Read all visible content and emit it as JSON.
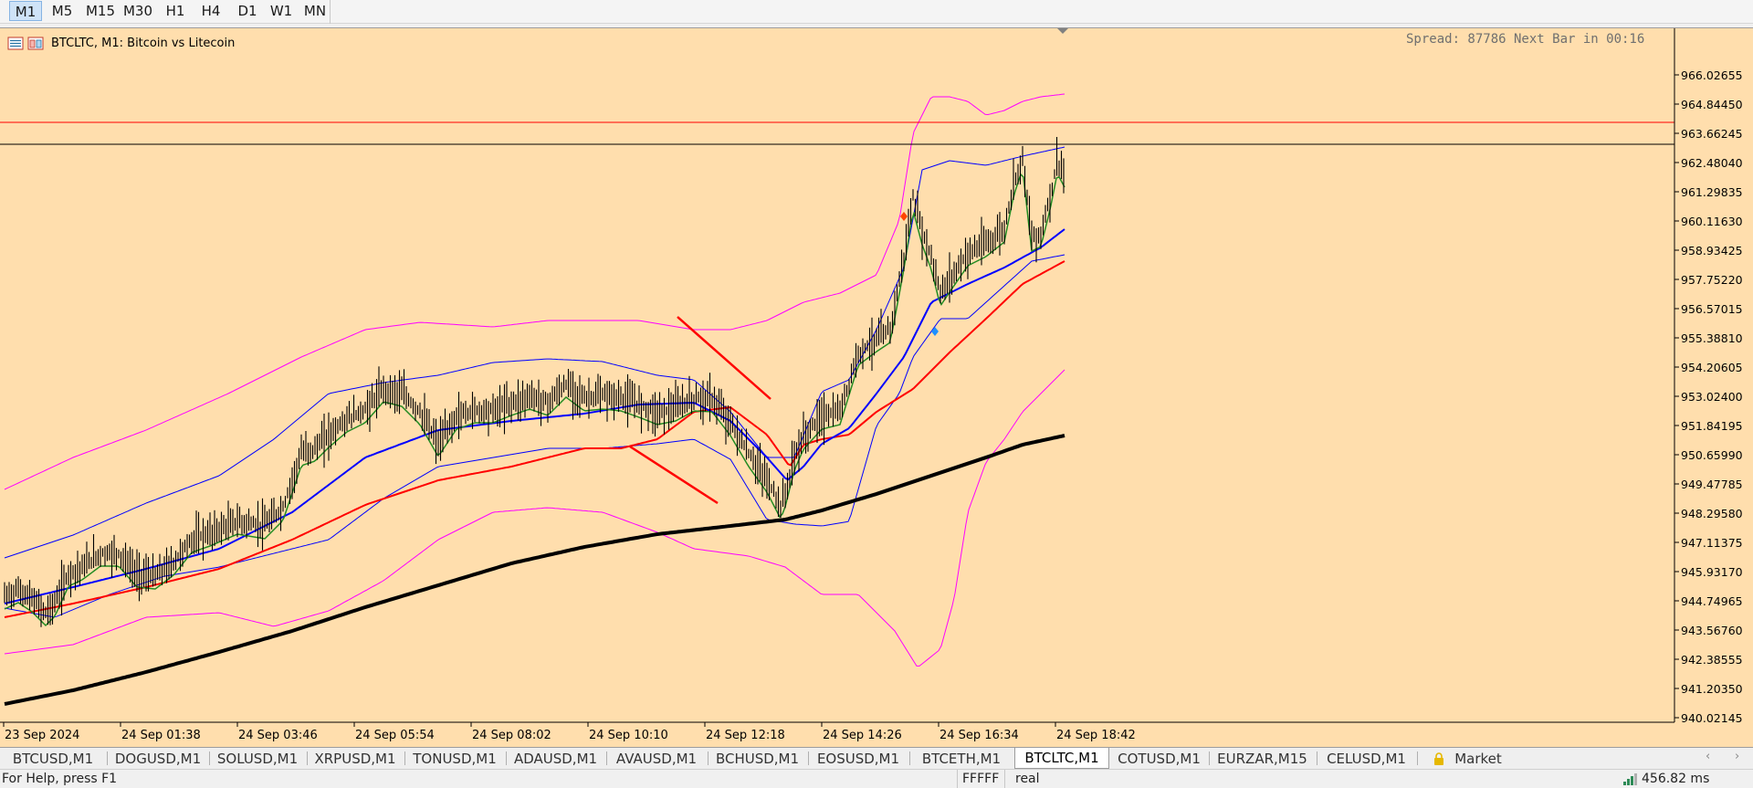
{
  "toolbar": {
    "timeframes": [
      {
        "label": "M1",
        "active": true
      },
      {
        "label": "M5",
        "active": false
      },
      {
        "label": "M15",
        "active": false
      },
      {
        "label": "M30",
        "active": false
      },
      {
        "label": "H1",
        "active": false
      },
      {
        "label": "H4",
        "active": false
      },
      {
        "label": "D1",
        "active": false
      },
      {
        "label": "W1",
        "active": false
      },
      {
        "label": "MN",
        "active": false
      }
    ]
  },
  "chart": {
    "title": "BTCLTC, M1:  Bitcoin vs Litecoin",
    "spread_text": "Spread: 87786 Next Bar in 00:16",
    "icons": [
      "chart-list-icon",
      "chart-window-icon"
    ],
    "price_axis": [
      "966.02655",
      "964.84450",
      "963.66245",
      "962.48040",
      "961.29835",
      "960.11630",
      "958.93425",
      "957.75220",
      "956.57015",
      "955.38810",
      "954.20605",
      "953.02400",
      "951.84195",
      "950.65990",
      "949.47785",
      "948.29580",
      "947.11375",
      "945.93170",
      "944.74965",
      "943.56760",
      "942.38555",
      "941.20350",
      "940.02145"
    ],
    "time_axis": [
      "23 Sep 2024",
      "24 Sep 01:38",
      "24 Sep 03:46",
      "24 Sep 05:54",
      "24 Sep 08:02",
      "24 Sep 10:10",
      "24 Sep 12:18",
      "24 Sep 14:26",
      "24 Sep 16:34",
      "24 Sep 18:42"
    ],
    "ask_price_tag": "963.14225",
    "bid_price_tag": "962.26439",
    "colors": {
      "background": "#ffdead",
      "ask_line": "#ff0000",
      "bid_line": "#000000",
      "price_bars": "#000000",
      "ma_fast": "#228b22",
      "ma_mid": "#0000ff",
      "ma_slow": "#ff0000",
      "ma_long": "#000000",
      "bollinger_inner": "#0000ff",
      "bollinger_outer": "#ff00ff",
      "trendlines": "#ff0000"
    }
  },
  "tabs": {
    "items": [
      {
        "label": "BTCUSD,M1",
        "active": false
      },
      {
        "label": "DOGUSD,M1",
        "active": false
      },
      {
        "label": "SOLUSD,M1",
        "active": false
      },
      {
        "label": "XRPUSD,M1",
        "active": false
      },
      {
        "label": "TONUSD,M1",
        "active": false
      },
      {
        "label": "ADAUSD,M1",
        "active": false
      },
      {
        "label": "AVAUSD,M1",
        "active": false
      },
      {
        "label": "BCHUSD,M1",
        "active": false
      },
      {
        "label": "EOSUSD,M1",
        "active": false
      },
      {
        "label": "BTCETH,M1",
        "active": false
      },
      {
        "label": "BTCLTC,M1",
        "active": true
      },
      {
        "label": "COTUSD,M1",
        "active": false
      },
      {
        "label": "EURZAR,M15",
        "active": false
      },
      {
        "label": "CELUSD,M1",
        "active": false
      },
      {
        "label": "Market",
        "active": false
      }
    ],
    "scroll_left": "‹",
    "scroll_right": "›"
  },
  "statusbar": {
    "help": "For Help, press F1",
    "profile": "FFFFF",
    "account": "real",
    "ping": "456.82 ms"
  }
}
